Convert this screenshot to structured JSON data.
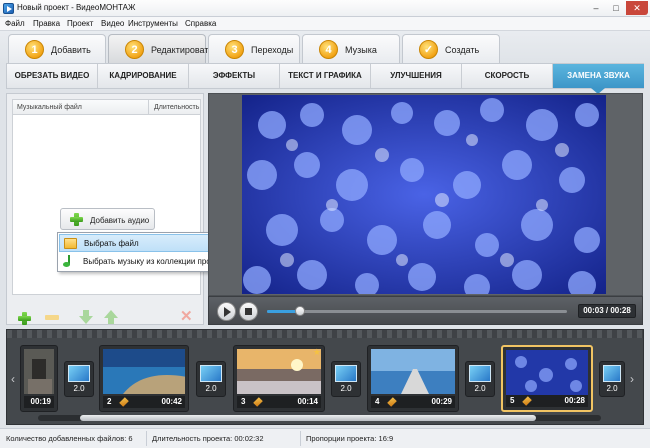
{
  "window": {
    "title": "Новый проект - ВидеоМОНТАЖ",
    "min": "‒",
    "max": "□",
    "close": "✕"
  },
  "menu": [
    "Файл",
    "Правка",
    "Проект",
    "Видео",
    "Инструменты",
    "Справка"
  ],
  "steps": [
    {
      "num": "1",
      "label": "Добавить"
    },
    {
      "num": "2",
      "label": "Редактировать",
      "active": true
    },
    {
      "num": "3",
      "label": "Переходы"
    },
    {
      "num": "4",
      "label": "Музыка"
    },
    {
      "num": "✓",
      "label": "Создать"
    }
  ],
  "subtabs": [
    "ОБРЕЗАТЬ ВИДЕО",
    "КАДРИРОВАНИЕ",
    "ЭФФЕКТЫ",
    "ТЕКСТ И ГРАФИКА",
    "УЛУЧШЕНИЯ",
    "СКОРОСТЬ",
    "ЗАМЕНА ЗВУКА"
  ],
  "active_subtab": "ЗАМЕНА ЗВУКА",
  "music_panel": {
    "col_file": "Музыкальный файл",
    "col_duration": "Длительность",
    "add_audio": "Добавить аудио",
    "menu_items": [
      "Выбрать файл",
      "Выбрать музыку из коллекции программы"
    ]
  },
  "player": {
    "timecode": "00:03 / 00:28",
    "progress": 0.11
  },
  "timeline": {
    "clips": [
      {
        "num": "",
        "duration": "00:19"
      },
      {
        "num": "2",
        "duration": "00:42"
      },
      {
        "num": "3",
        "duration": "00:14"
      },
      {
        "num": "4",
        "duration": "00:29"
      },
      {
        "num": "5",
        "duration": "00:28",
        "selected": true
      }
    ],
    "transitions": [
      "2.0",
      "2.0",
      "2.0",
      "2.0",
      "2.0"
    ]
  },
  "status": {
    "files": "Количество добавленных файлов: 6",
    "duration": "Длительность проекта: 00:02:32",
    "ratio": "Пропорции проекта: 16:9"
  },
  "colors": {
    "accent": "#3d96c8",
    "step_badge": "#f2a417",
    "selected_clip": "#f1c463"
  }
}
